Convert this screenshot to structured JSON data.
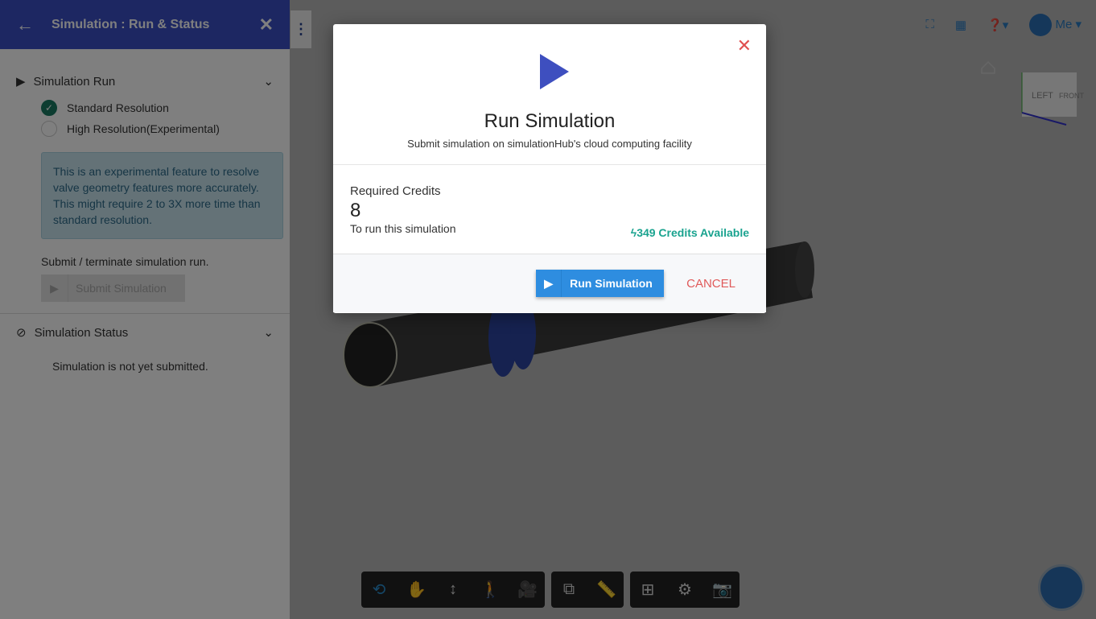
{
  "sidebar": {
    "title": "Simulation : Run & Status",
    "run_section": "Simulation Run",
    "options": [
      {
        "label": "Standard Resolution",
        "selected": true
      },
      {
        "label": "High Resolution(Experimental)",
        "selected": false
      }
    ],
    "info": "This is an experimental feature to resolve valve geometry features more accurately. This might require 2 to 3X more time than standard resolution.",
    "submit_label": "Submit / terminate simulation run.",
    "submit_button": "Submit Simulation",
    "status_section": "Simulation Status",
    "status_text": "Simulation is not yet submitted."
  },
  "topbar": {
    "user": "Me"
  },
  "viewcube": {
    "left": "LEFT",
    "front": "FRONT"
  },
  "modal": {
    "title": "Run Simulation",
    "subtitle": "Submit simulation on simulationHub's cloud computing facility",
    "required_label": "Required Credits",
    "required_value": "8",
    "required_sub": "To run this simulation",
    "available": "349 Credits Available",
    "run_button": "Run Simulation",
    "cancel": "CANCEL"
  }
}
